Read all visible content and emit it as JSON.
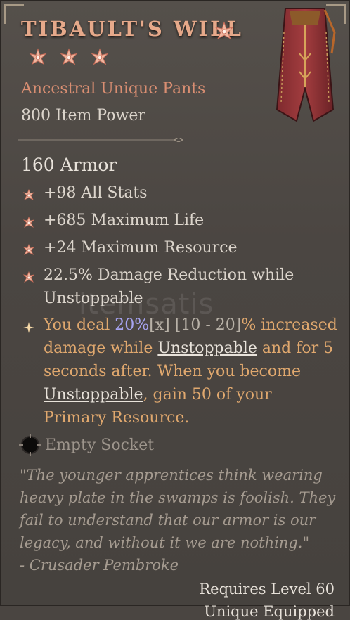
{
  "item": {
    "name": "TIBAULT'S WILL",
    "type": "Ancestral Unique Pants",
    "item_power": "800 Item Power",
    "armor": "160 Armor",
    "stats": [
      "+98 All Stats",
      "+685 Maximum Life",
      "+24 Maximum Resource",
      "22.5% Damage Reduction while Unstoppable"
    ],
    "unique": {
      "p1": "You deal ",
      "value": "20%",
      "mult": "[x]",
      "range": " [10 - 20]",
      "p2": "% increased damage while ",
      "kw1": "Unstoppable",
      "p3": " and for 5 seconds after. When you become ",
      "kw2": "Unstoppable",
      "p4": ", gain 50 of your Primary Resource."
    },
    "socket": "Empty Socket",
    "flavor": "\"The younger apprentices think wearing heavy plate in the swamps is foolish. They fail to understand that our armor is our legacy, and without it we are nothing.\"",
    "flavor_author": "- Crusader Pembroke",
    "requires": "Requires Level 60",
    "cutoff_line": "Unique Equipped"
  },
  "watermark": "itemsatis",
  "colors": {
    "title": "#e6a98a",
    "type": "#d98e72",
    "unique_text": "#e0a86e",
    "highlight": "#a7a4f2"
  },
  "icons": [
    "greater-affix-star-icon",
    "star-bullet-icon",
    "unique-power-icon",
    "socket-icon",
    "pants-item-icon"
  ]
}
